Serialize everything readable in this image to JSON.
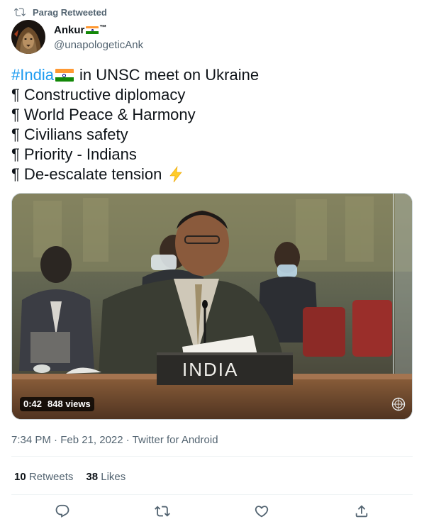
{
  "retweet": {
    "text": "Parag Retweeted"
  },
  "author": {
    "name": "Ankur",
    "suffix": "™",
    "handle": "@unapologeticAnk"
  },
  "tweet": {
    "hashtag": "#India",
    "headline_rest": "in UNSC meet on Ukraine",
    "points": [
      "¶ Constructive diplomacy",
      "¶ World Peace & Harmony",
      "¶ Civilians safety",
      "¶ Priority - Indians",
      "¶ De-escalate tension"
    ]
  },
  "media": {
    "nameplate": "INDIA",
    "duration": "0:42",
    "views": "848 views"
  },
  "meta": {
    "time": "7:34 PM · Feb 21, 2022 · Twitter for Android"
  },
  "stats": {
    "retweets_count": "10",
    "retweets_label": "Retweets",
    "likes_count": "38",
    "likes_label": "Likes"
  },
  "icons": [
    "retweet-icon",
    "lightning-icon",
    "un-logo-icon",
    "reply-icon",
    "like-icon",
    "share-icon"
  ],
  "colors": {
    "link": "#1d9bf0",
    "secondary_text": "#536471",
    "primary_text": "#0f1419"
  }
}
